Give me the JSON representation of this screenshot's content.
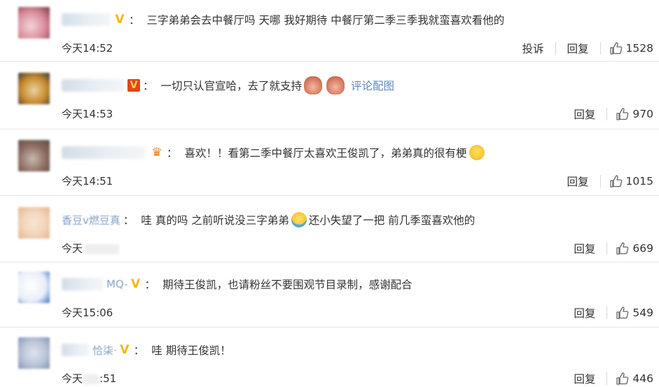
{
  "comments": [
    {
      "nick": "可爱",
      "badge": "V",
      "text": "三字弟弟会去中餐厅吗 天哪 我好期待 中餐厅第二季三季我就蛮喜欢看他的",
      "time": "今天14:52",
      "report": "投诉",
      "reply": "回复",
      "likes": "1528",
      "avatar_colors": [
        "#d98a9a",
        "#f2d5d8",
        "#7a3a44"
      ]
    },
    {
      "nick": "",
      "badge": "V",
      "text": "一切只认官宣哈，去了就支持",
      "link": "评论配图",
      "time": "今天14:53",
      "reply": "回复",
      "likes": "970",
      "avatar_colors": [
        "#e6d3a3",
        "#c98a2c",
        "#3a3a3a"
      ]
    },
    {
      "nick": "",
      "text": "喜欢！！看第二季中餐厅太喜欢王俊凯了，弟弟真的很有梗",
      "time": "今天14:51",
      "reply": "回复",
      "likes": "1015",
      "avatar_colors": [
        "#c9b8b0",
        "#8a6b5e",
        "#5a4a44"
      ]
    },
    {
      "nick": "香豆v燃豆真",
      "text": "哇 真的吗 之前听说没三字弟弟",
      "text2": "还小失望了一把 前几季蛮喜欢他的",
      "time": "今天",
      "reply": "回复",
      "likes": "669",
      "avatar_colors": [
        "#f3d6bb",
        "#e5b48e",
        "#f7e6d6"
      ]
    },
    {
      "nick": "MQ-",
      "badge": "V",
      "text": "期待王俊凯，也请粉丝不要围观节目录制，感谢配合",
      "time": "今天15:06",
      "reply": "回复",
      "likes": "549",
      "avatar_colors": [
        "#ffffff",
        "#e8eef8",
        "#3a6fc0"
      ]
    },
    {
      "nick": "恰柒·",
      "badge": "V",
      "text": "哇 期待王俊凯！",
      "time": "今天",
      "time_suffix": ":51",
      "reply": "回复",
      "likes": "446",
      "avatar_colors": [
        "#b9c4d8",
        "#8595b2",
        "#dfe4ee"
      ]
    }
  ],
  "icons": {
    "like": "thumbs-up-icon",
    "verified": "v-badge-icon",
    "crown": "crown-icon",
    "emoji_laugh": "laugh-emoji-icon",
    "emoji_cry": "cry-laugh-emoji-icon",
    "emoji_monkey": "monkey-emoji-icon"
  },
  "colors": {
    "link": "#5b86c5",
    "verified": "#f2b711",
    "text": "#333333",
    "divider": "#e6e6e6"
  }
}
